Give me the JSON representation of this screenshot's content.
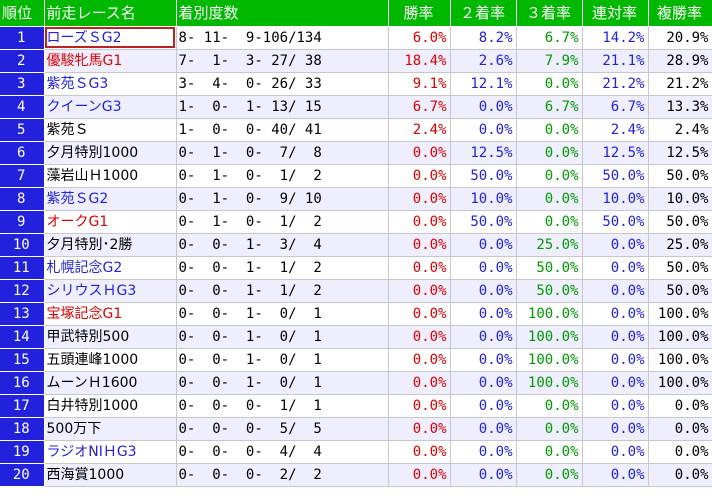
{
  "headers": {
    "rank": "順位",
    "race": "前走レース名",
    "record": "着別度数",
    "win": "勝率",
    "place2": "２着率",
    "place3": "３着率",
    "rentai": "連対率",
    "fukusho": "複勝率"
  },
  "colors": {
    "header_bg": "#00b800",
    "rank_bg": "#2222dd",
    "win_rate": "#e00000",
    "place2_rate": "#2222dd",
    "place3_rate": "#009900",
    "rentai_rate": "#2222dd",
    "fukusho_rate": "#000000",
    "name_red": "#e00000",
    "name_blue": "#2222dd"
  },
  "rows": [
    {
      "rank": "1",
      "race": "ローズＳG2",
      "race_color": "blue",
      "record": "8- 11-  9-106/134",
      "win": "6.0%",
      "place2": "8.2%",
      "place3": "6.7%",
      "rentai": "14.2%",
      "fukusho": "20.9%"
    },
    {
      "rank": "2",
      "race": "優駿牝馬G1",
      "race_color": "red",
      "record": "7-  1-  3- 27/ 38",
      "win": "18.4%",
      "place2": "2.6%",
      "place3": "7.9%",
      "rentai": "21.1%",
      "fukusho": "28.9%"
    },
    {
      "rank": "3",
      "race": "紫苑ＳG3",
      "race_color": "blue",
      "record": "3-  4-  0- 26/ 33",
      "win": "9.1%",
      "place2": "12.1%",
      "place3": "0.0%",
      "rentai": "21.2%",
      "fukusho": "21.2%"
    },
    {
      "rank": "4",
      "race": "クイーンG3",
      "race_color": "blue",
      "record": "1-  0-  1- 13/ 15",
      "win": "6.7%",
      "place2": "0.0%",
      "place3": "6.7%",
      "rentai": "6.7%",
      "fukusho": "13.3%"
    },
    {
      "rank": "5",
      "race": "紫苑Ｓ",
      "race_color": "black",
      "record": "1-  0-  0- 40/ 41",
      "win": "2.4%",
      "place2": "0.0%",
      "place3": "0.0%",
      "rentai": "2.4%",
      "fukusho": "2.4%"
    },
    {
      "rank": "6",
      "race": "夕月特別1000",
      "race_color": "black",
      "record": "0-  1-  0-  7/  8",
      "win": "0.0%",
      "place2": "12.5%",
      "place3": "0.0%",
      "rentai": "12.5%",
      "fukusho": "12.5%"
    },
    {
      "rank": "7",
      "race": "藻岩山Ｈ1000",
      "race_color": "black",
      "record": "0-  1-  0-  1/  2",
      "win": "0.0%",
      "place2": "50.0%",
      "place3": "0.0%",
      "rentai": "50.0%",
      "fukusho": "50.0%"
    },
    {
      "rank": "8",
      "race": "紫苑ＳG2",
      "race_color": "blue",
      "record": "0-  1-  0-  9/ 10",
      "win": "0.0%",
      "place2": "10.0%",
      "place3": "0.0%",
      "rentai": "10.0%",
      "fukusho": "10.0%"
    },
    {
      "rank": "9",
      "race": "オークG1",
      "race_color": "red",
      "record": "0-  1-  0-  1/  2",
      "win": "0.0%",
      "place2": "50.0%",
      "place3": "0.0%",
      "rentai": "50.0%",
      "fukusho": "50.0%"
    },
    {
      "rank": "10",
      "race": "夕月特別･2勝",
      "race_color": "black",
      "record": "0-  0-  1-  3/  4",
      "win": "0.0%",
      "place2": "0.0%",
      "place3": "25.0%",
      "rentai": "0.0%",
      "fukusho": "25.0%"
    },
    {
      "rank": "11",
      "race": "札幌記念G2",
      "race_color": "blue",
      "record": "0-  0-  1-  1/  2",
      "win": "0.0%",
      "place2": "0.0%",
      "place3": "50.0%",
      "rentai": "0.0%",
      "fukusho": "50.0%"
    },
    {
      "rank": "12",
      "race": "シリウスＨG3",
      "race_color": "blue",
      "record": "0-  0-  1-  1/  2",
      "win": "0.0%",
      "place2": "0.0%",
      "place3": "50.0%",
      "rentai": "0.0%",
      "fukusho": "50.0%"
    },
    {
      "rank": "13",
      "race": "宝塚記念G1",
      "race_color": "red",
      "record": "0-  0-  1-  0/  1",
      "win": "0.0%",
      "place2": "0.0%",
      "place3": "100.0%",
      "rentai": "0.0%",
      "fukusho": "100.0%"
    },
    {
      "rank": "14",
      "race": "甲武特別500",
      "race_color": "black",
      "record": "0-  0-  1-  0/  1",
      "win": "0.0%",
      "place2": "0.0%",
      "place3": "100.0%",
      "rentai": "0.0%",
      "fukusho": "100.0%"
    },
    {
      "rank": "15",
      "race": "五頭連峰1000",
      "race_color": "black",
      "record": "0-  0-  1-  0/  1",
      "win": "0.0%",
      "place2": "0.0%",
      "place3": "100.0%",
      "rentai": "0.0%",
      "fukusho": "100.0%"
    },
    {
      "rank": "16",
      "race": "ムーンＨ1600",
      "race_color": "black",
      "record": "0-  0-  1-  0/  1",
      "win": "0.0%",
      "place2": "0.0%",
      "place3": "100.0%",
      "rentai": "0.0%",
      "fukusho": "100.0%"
    },
    {
      "rank": "17",
      "race": "白井特別1000",
      "race_color": "black",
      "record": "0-  0-  0-  1/  1",
      "win": "0.0%",
      "place2": "0.0%",
      "place3": "0.0%",
      "rentai": "0.0%",
      "fukusho": "0.0%"
    },
    {
      "rank": "18",
      "race": "500万下",
      "race_color": "black",
      "record": "0-  0-  0-  5/  5",
      "win": "0.0%",
      "place2": "0.0%",
      "place3": "0.0%",
      "rentai": "0.0%",
      "fukusho": "0.0%"
    },
    {
      "rank": "19",
      "race": "ラジオNIＨG3",
      "race_color": "blue",
      "record": "0-  0-  0-  4/  4",
      "win": "0.0%",
      "place2": "0.0%",
      "place3": "0.0%",
      "rentai": "0.0%",
      "fukusho": "0.0%"
    },
    {
      "rank": "20",
      "race": "西海賞1000",
      "race_color": "black",
      "record": "0-  0-  0-  2/  2",
      "win": "0.0%",
      "place2": "0.0%",
      "place3": "0.0%",
      "rentai": "0.0%",
      "fukusho": "0.0%"
    }
  ]
}
